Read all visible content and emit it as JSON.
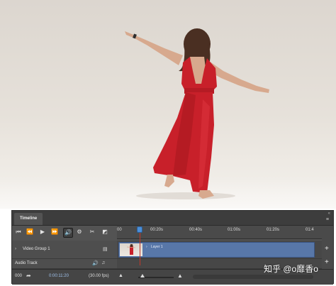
{
  "timeline": {
    "tab_label": "Timeline",
    "double_arrow": "«",
    "menu_icon": "≡",
    "ruler_ticks": [
      "00",
      "00:20s",
      "00:40s",
      "01:00s",
      "01:20s",
      "01:4"
    ],
    "tracks": [
      {
        "name": "Video Group 1",
        "clip_label": "Layer 1"
      },
      {
        "name": "Audio Track"
      }
    ],
    "bottom": {
      "frame_code": "000",
      "timecode": "0:00:11:20",
      "fps": "(30.00 fps)"
    }
  },
  "watermark": "知乎 @o靡香o",
  "colors": {
    "panel": "#535353",
    "clip": "#5877a8",
    "playhead": "#4b8fd8",
    "dress": "#c8202a"
  }
}
